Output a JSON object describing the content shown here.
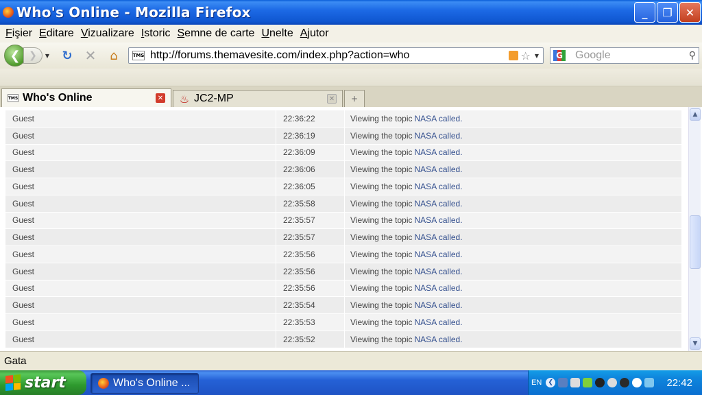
{
  "window": {
    "title": "Who's Online - Mozilla Firefox",
    "minimize": "_",
    "maximize": "❐",
    "close": "✕"
  },
  "menu": [
    "Fişier",
    "Editare",
    "Vizualizare",
    "Istoric",
    "Semne de carte",
    "Unelte",
    "Ajutor"
  ],
  "nav": {
    "url": "http://forums.themavesite.com/index.php?action=who",
    "site_badge": "TMS",
    "search_placeholder": "Google",
    "search_engine": "G"
  },
  "tabs": [
    {
      "label": "Who's Online",
      "favicon": "TMS",
      "active": true
    },
    {
      "label": "JC2-MP",
      "favicon": "♨",
      "active": false
    }
  ],
  "new_tab": "+",
  "rows": [
    {
      "user": "Guest",
      "time": "22:36:22",
      "action": "Viewing the topic",
      "topic": "NASA called."
    },
    {
      "user": "Guest",
      "time": "22:36:19",
      "action": "Viewing the topic",
      "topic": "NASA called."
    },
    {
      "user": "Guest",
      "time": "22:36:09",
      "action": "Viewing the topic",
      "topic": "NASA called."
    },
    {
      "user": "Guest",
      "time": "22:36:06",
      "action": "Viewing the topic",
      "topic": "NASA called."
    },
    {
      "user": "Guest",
      "time": "22:36:05",
      "action": "Viewing the topic",
      "topic": "NASA called."
    },
    {
      "user": "Guest",
      "time": "22:35:58",
      "action": "Viewing the topic",
      "topic": "NASA called."
    },
    {
      "user": "Guest",
      "time": "22:35:57",
      "action": "Viewing the topic",
      "topic": "NASA called."
    },
    {
      "user": "Guest",
      "time": "22:35:57",
      "action": "Viewing the topic",
      "topic": "NASA called."
    },
    {
      "user": "Guest",
      "time": "22:35:56",
      "action": "Viewing the topic",
      "topic": "NASA called."
    },
    {
      "user": "Guest",
      "time": "22:35:56",
      "action": "Viewing the topic",
      "topic": "NASA called."
    },
    {
      "user": "Guest",
      "time": "22:35:56",
      "action": "Viewing the topic",
      "topic": "NASA called."
    },
    {
      "user": "Guest",
      "time": "22:35:54",
      "action": "Viewing the topic",
      "topic": "NASA called."
    },
    {
      "user": "Guest",
      "time": "22:35:53",
      "action": "Viewing the topic",
      "topic": "NASA called."
    },
    {
      "user": "Guest",
      "time": "22:35:52",
      "action": "Viewing the topic",
      "topic": "NASA called."
    }
  ],
  "status": "Gata",
  "taskbar": {
    "start": "start",
    "task_label": "Who's Online ...",
    "lang": "EN",
    "clock": "22:42"
  },
  "colors": {
    "link": "#334f8e",
    "titlebar": "#1d6ae6",
    "start": "#2e9a2e"
  }
}
